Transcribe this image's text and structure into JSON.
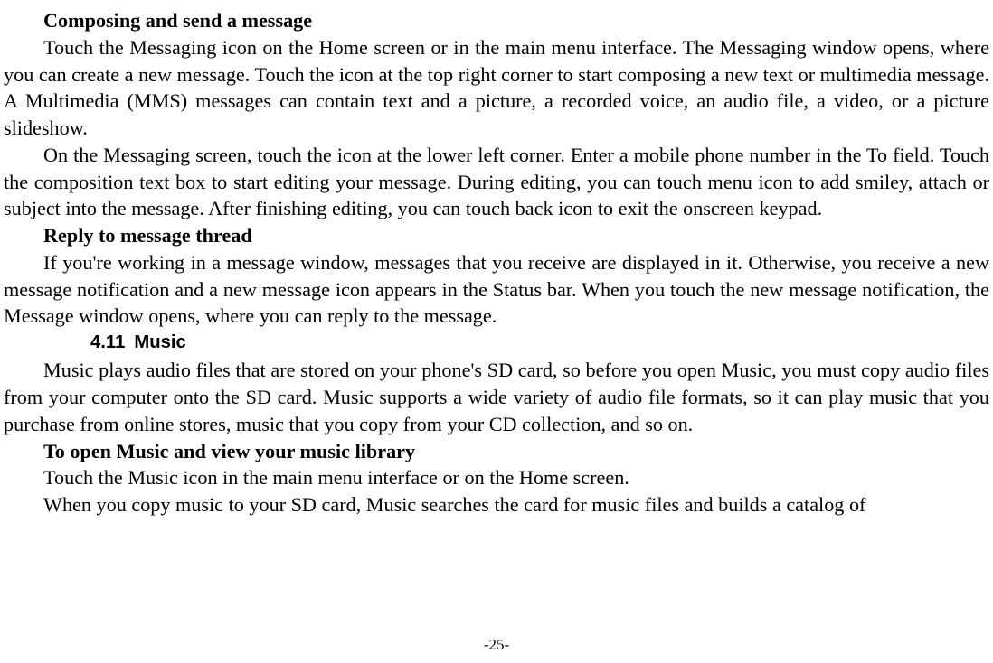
{
  "heading1": "Composing and send a message",
  "para1": "Touch the Messaging icon on the Home screen or in the main menu interface. The Messaging window opens, where you can create a new message. Touch the icon at the top right corner to start composing a new text or multimedia message. A Multimedia (MMS) messages can contain text and a picture, a recorded voice, an audio file, a video, or a picture slideshow.",
  "para2": "On the Messaging screen, touch the icon at the lower left corner. Enter a mobile phone number in the To field. Touch the composition text box to start editing your message. During editing, you can touch menu icon to add smiley, attach or subject into the message. After finishing editing, you can touch back icon to exit the onscreen keypad.",
  "heading2": "Reply to message thread",
  "para3": "If you're working in a message window, messages that you receive are displayed in it. Otherwise, you receive a new message notification and a new message icon appears in the Status bar. When you touch the new message notification, the Message window opens, where you can reply to the message.",
  "section_number": "4.11",
  "section_title": "Music",
  "para4": "Music plays audio files that are stored on your phone's SD card, so before you open Music, you must copy audio files from your computer onto the SD card. Music supports a wide variety of audio file formats, so it can play music that you purchase from online stores, music that you copy from your CD collection, and so on.",
  "heading3": "To open Music and view your music library",
  "para5": "Touch the Music icon in the main menu interface or on the Home screen.",
  "para6": "When you copy music to your SD card, Music searches the card for music files and builds a catalog of",
  "page_number": "-25-"
}
